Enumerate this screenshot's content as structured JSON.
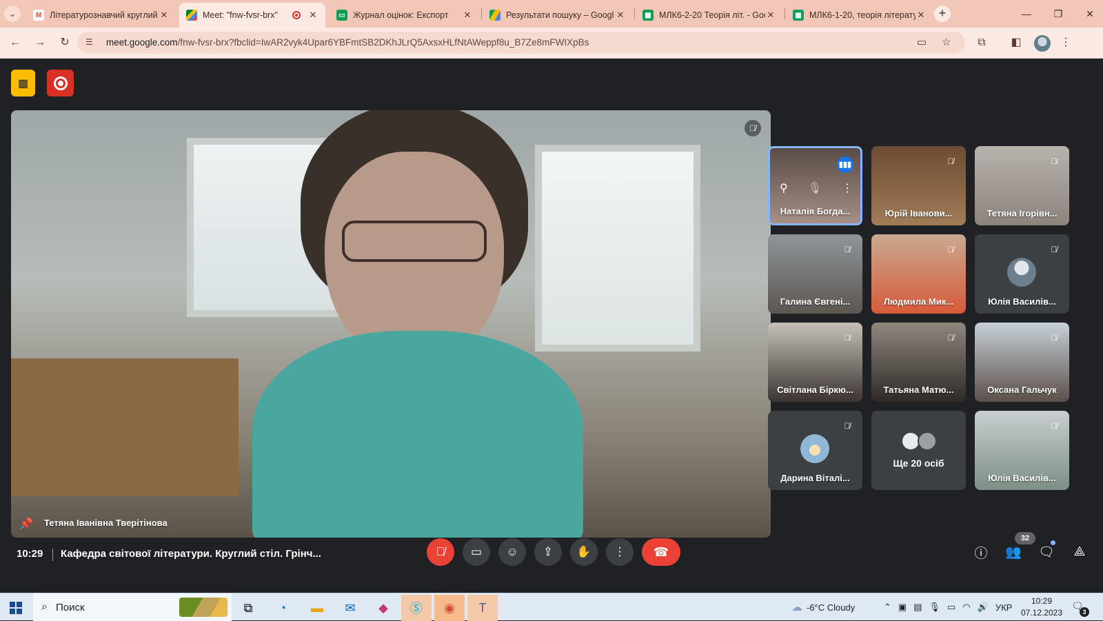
{
  "browser": {
    "tabs": [
      {
        "title": "Літературознавчий круглий",
        "favicon": "gmail-icon",
        "active": false
      },
      {
        "title": "Meet: \"fnw-fvsr-brx\"",
        "favicon": "meet-icon",
        "active": true,
        "recording": true
      },
      {
        "title": "Журнал оцінок: Експорт",
        "favicon": "classroom-icon",
        "active": false
      },
      {
        "title": "Результати пошуку – Googl",
        "favicon": "drive-icon",
        "active": false
      },
      {
        "title": "МЛК6-2-20 Теорія літ. - Goo",
        "favicon": "sheets-icon",
        "active": false
      },
      {
        "title": "МЛК6-1-20, теорія літерату",
        "favicon": "sheets-icon",
        "active": false
      }
    ],
    "url_domain": "meet.google.com",
    "url_path": "/fnw-fvsr-brx?fbclid=IwAR2vyk4Upar6YBFmtSB2DKhJLrQ5AxsxHLfNtAWeppf8u_B7Ze8mFWIXpBs"
  },
  "meet": {
    "main_speaker": "Тетяна Іванівна Тверітінова",
    "participants": [
      {
        "name": "Наталія Богда...",
        "speaking": true,
        "hovered": true
      },
      {
        "name": "Юрій Іванови...",
        "muted": true
      },
      {
        "name": "Тетяна Ігорівн...",
        "muted": true
      },
      {
        "name": "Галина Євгені...",
        "muted": true
      },
      {
        "name": "Людмила Мик...",
        "muted": true
      },
      {
        "name": "Юлія Василів...",
        "muted": true
      },
      {
        "name": "Світлана Біркю...",
        "muted": true
      },
      {
        "name": "Татьяна Матю...",
        "muted": true
      },
      {
        "name": "Оксана Гальчук",
        "muted": true
      },
      {
        "name": "Дарина Віталі...",
        "muted": true
      },
      {
        "name": "Юлія Василів...",
        "muted": true
      }
    ],
    "more_label": "Ще 20 осіб",
    "time": "10:29",
    "meeting_title": "Кафедра світової літератури. Круглий стіл. Грінч...",
    "people_count": "32",
    "colors": {
      "accent": "#8ab4f8",
      "danger": "#ea4335",
      "background": "#202124"
    }
  },
  "taskbar": {
    "search_placeholder": "Поиск",
    "weather": "-6°C  Cloudy",
    "language": "УКР",
    "clock_time": "10:29",
    "clock_date": "07.12.2023",
    "notifications": "3"
  }
}
